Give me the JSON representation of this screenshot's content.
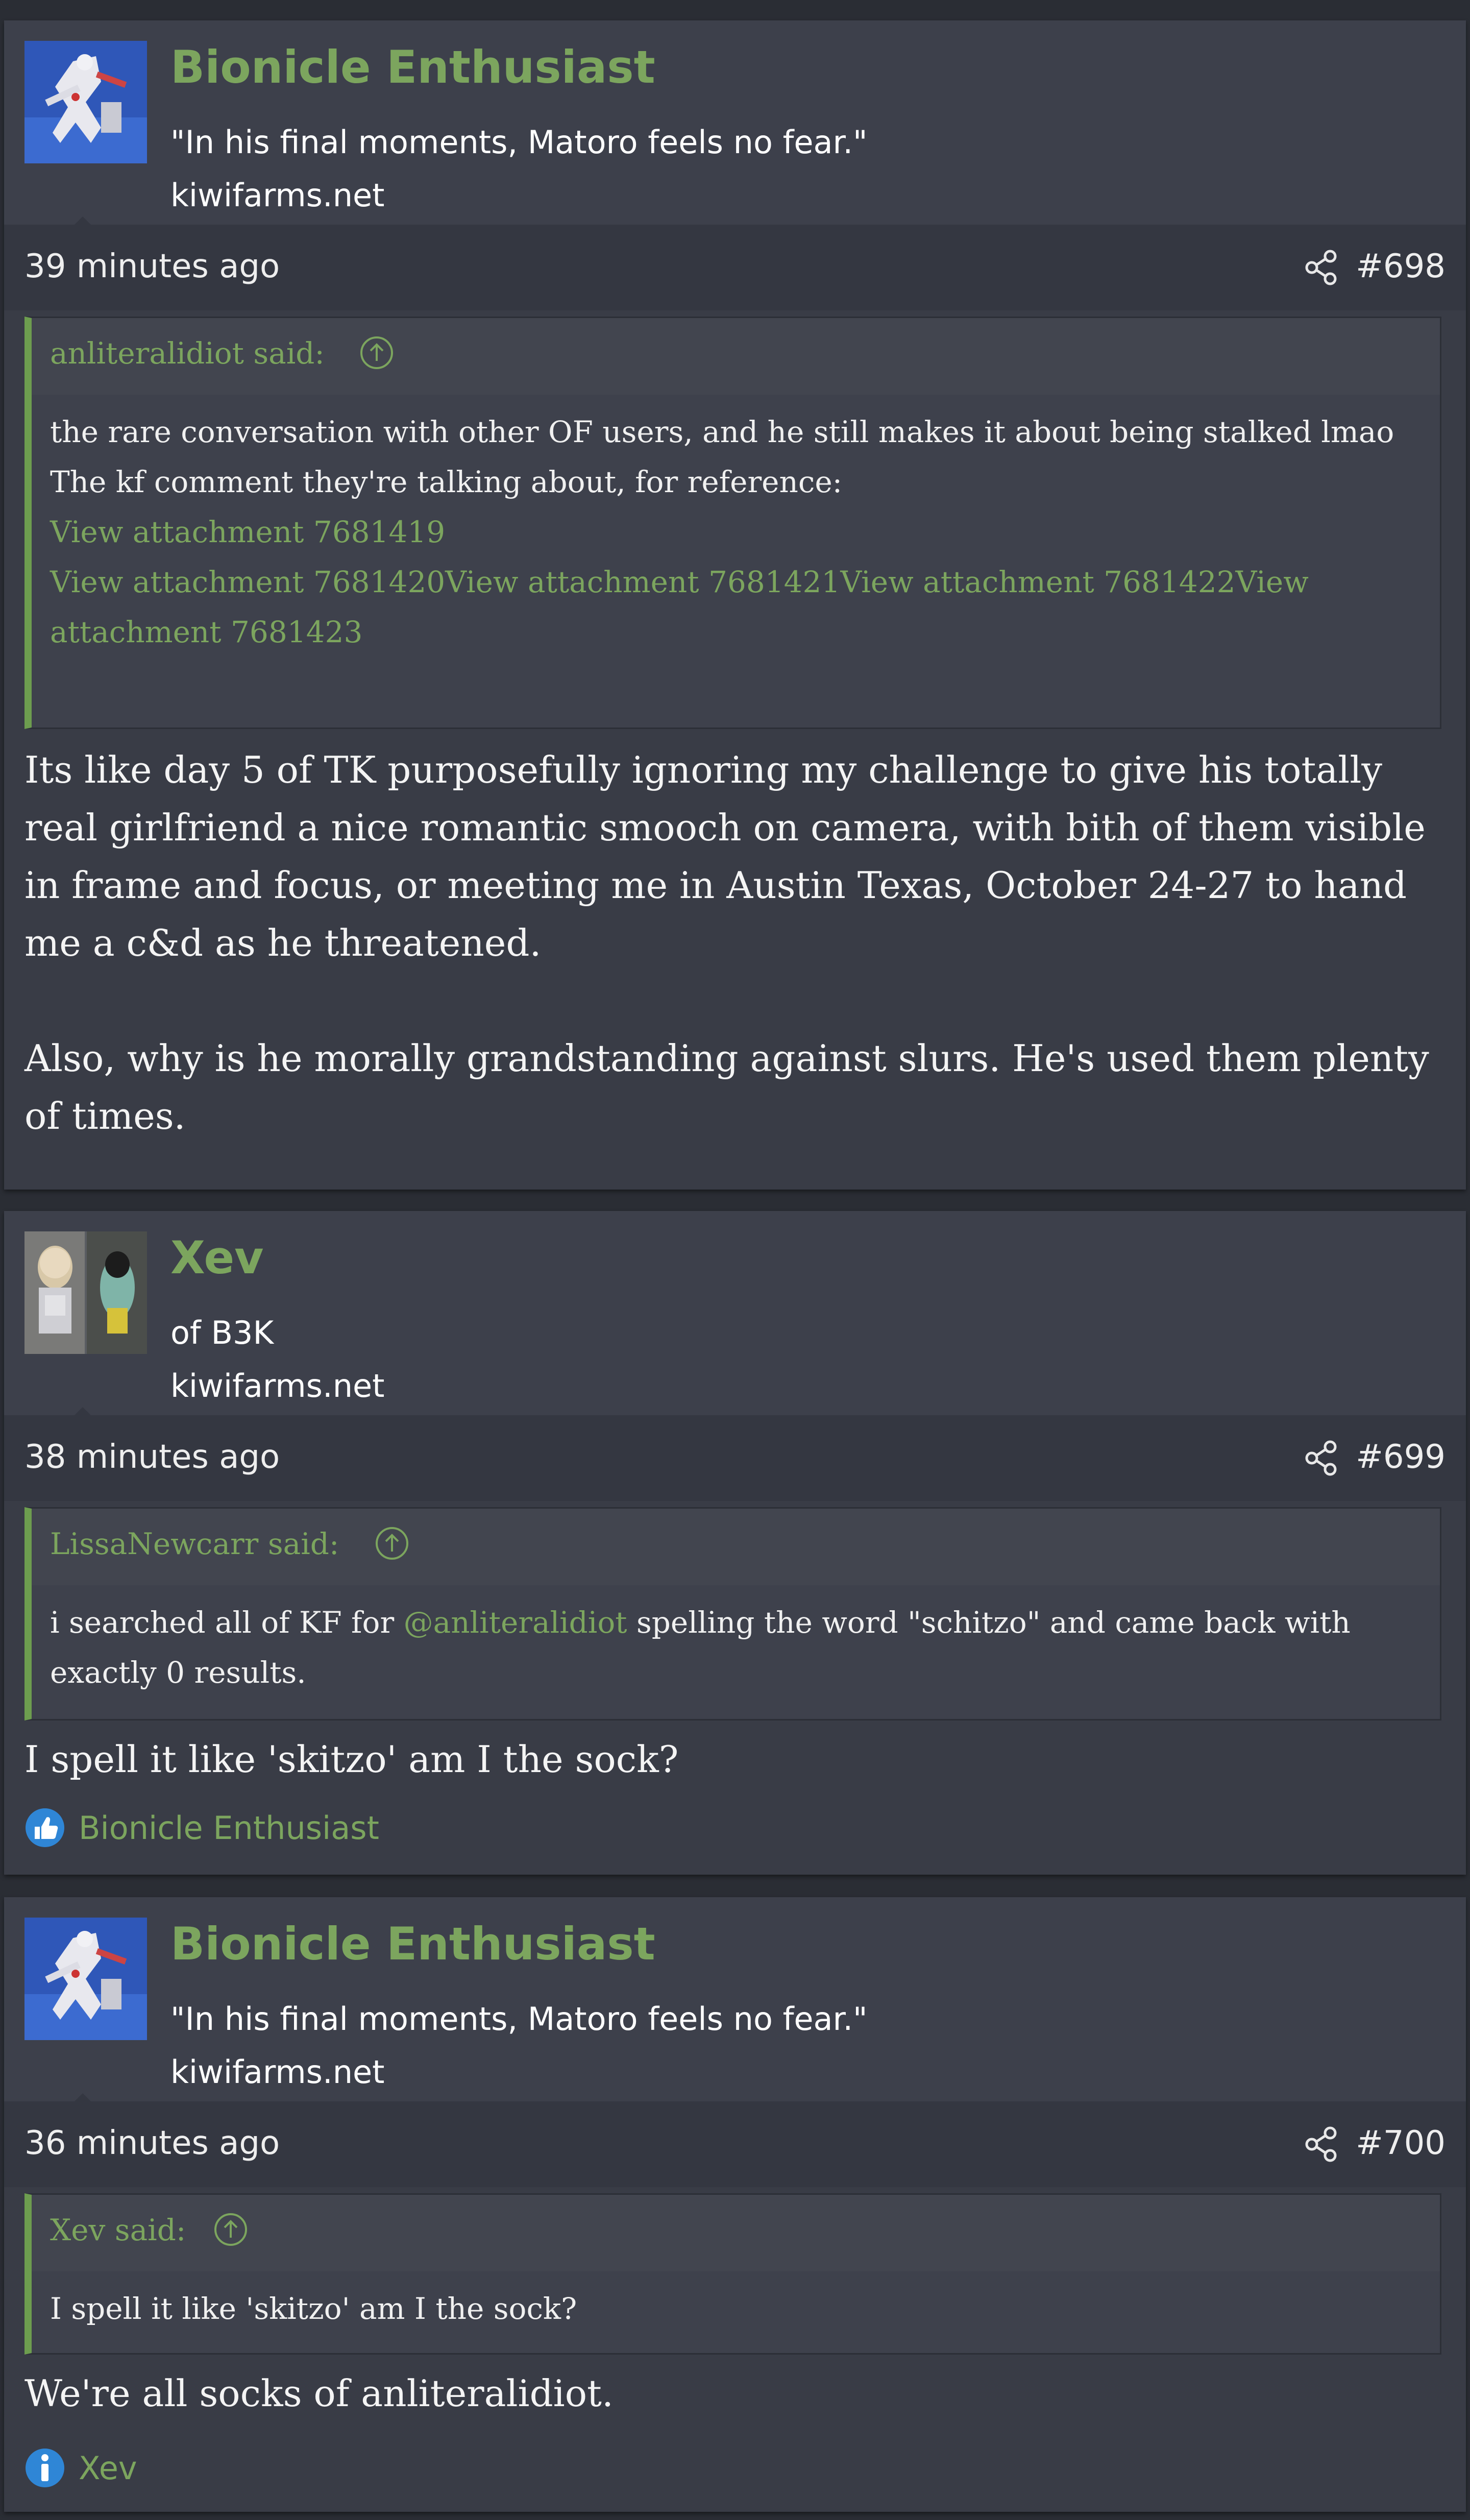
{
  "posts": [
    {
      "username": "Bionicle Enthusiast",
      "user_title": "\"In his final moments, Matoro feels no fear.\"",
      "user_site": "kiwifarms.net",
      "timestamp": "39 minutes ago",
      "post_number": "#698",
      "quote": {
        "author": "anliteralidiot said:",
        "lines": [
          "the rare conversation with other OF users, and he still makes it about being stalked lmao",
          "The kf comment they're talking about, for reference:"
        ],
        "attachment_1": "View attachment 7681419",
        "attachments_rest": "View attachment 7681420View attachment 7681421View attachment 7681422View attachment 7681423"
      },
      "message": [
        "Its like day 5 of TK purposefully ignoring my challenge to give his totally real girlfriend a nice romantic smooch on camera, with bith of them visible in frame and focus, or meeting me in Austin Texas, October 24-27 to hand me a c&d as he threatened.",
        "Also, why is he morally grandstanding against slurs. He's used them plenty of times."
      ]
    },
    {
      "username": "Xev",
      "user_title": "of B3K",
      "user_site": "kiwifarms.net",
      "timestamp": "38 minutes ago",
      "post_number": "#699",
      "quote": {
        "author": "LissaNewcarr said:",
        "text_before": "i searched all of KF for ",
        "mention": "@anliteralidiot",
        "text_after": " spelling the word \"schitzo\" and came back with exactly 0 results."
      },
      "message": [
        "I spell it like 'skitzo' am I the sock?"
      ],
      "reaction": {
        "icon": "like-icon",
        "user": "Bionicle Enthusiast"
      }
    },
    {
      "username": "Bionicle Enthusiast",
      "user_title": "\"In his final moments, Matoro feels no fear.\"",
      "user_site": "kiwifarms.net",
      "timestamp": "36 minutes ago",
      "post_number": "#700",
      "quote": {
        "author": "Xev said:",
        "text": "I spell it like 'skitzo' am I the sock?"
      },
      "message": [
        "We're all socks of anliteralidiot."
      ],
      "reaction": {
        "icon": "informative-icon",
        "user": "Xev"
      }
    }
  ],
  "colors": {
    "accent_green": "#7ca55e",
    "post_bg": "#393c46",
    "like_blue": "#2f86d6"
  }
}
